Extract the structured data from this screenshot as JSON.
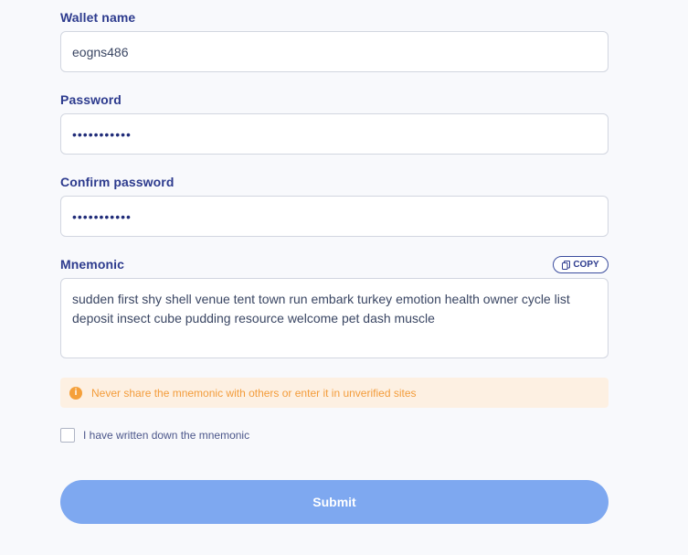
{
  "wallet_name": {
    "label": "Wallet name",
    "value": "eogns486"
  },
  "password": {
    "label": "Password",
    "value": "•••••••••••"
  },
  "confirm_password": {
    "label": "Confirm password",
    "value": "•••••••••••"
  },
  "mnemonic": {
    "label": "Mnemonic",
    "copy_label": "COPY",
    "value": "sudden first shy shell venue tent town run embark turkey emotion health owner cycle list deposit insect cube pudding resource welcome pet dash muscle"
  },
  "warning": {
    "icon": "info-icon",
    "icon_glyph": "i",
    "text": "Never share the mnemonic with others or enter it in unverified sites"
  },
  "checkbox": {
    "label": "I have written down the mnemonic",
    "checked": false
  },
  "submit": {
    "label": "Submit"
  },
  "colors": {
    "label": "#2d3b8e",
    "warning_bg": "#fdf0e2",
    "warning_text": "#f39c3b",
    "submit_bg": "#7ea8f0"
  }
}
